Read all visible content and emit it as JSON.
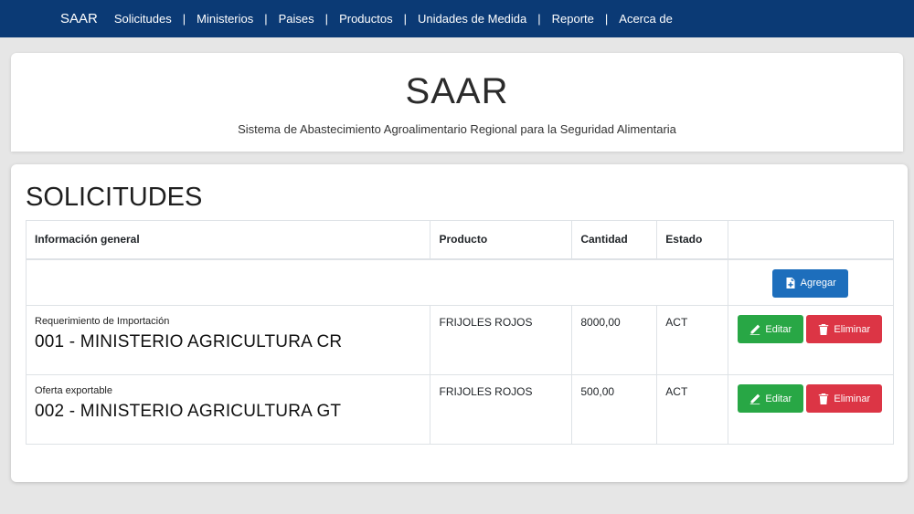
{
  "nav": {
    "brand": "SAAR",
    "items": [
      {
        "label": "Solicitudes"
      },
      {
        "label": "Ministerios"
      },
      {
        "label": "Paises"
      },
      {
        "label": "Productos"
      },
      {
        "label": "Unidades de Medida"
      },
      {
        "label": "Reporte"
      },
      {
        "label": "Acerca de"
      }
    ],
    "separator": "|"
  },
  "header": {
    "title": "SAAR",
    "subtitle": "Sistema de Abastecimiento Agroalimentario Regional para la Seguridad Alimentaria"
  },
  "main": {
    "title": "SOLICITUDES",
    "columns": {
      "info": "Información general",
      "product": "Producto",
      "quantity": "Cantidad",
      "status": "Estado"
    },
    "add_label": "Agregar",
    "edit_label": "Editar",
    "delete_label": "Eliminar",
    "rows": [
      {
        "type": "Requerimiento de Importación",
        "entity": "001 - MINISTERIO AGRICULTURA CR",
        "product": "FRIJOLES ROJOS",
        "quantity": "8000,00",
        "status": "ACT"
      },
      {
        "type": "Oferta exportable",
        "entity": "002 - MINISTERIO AGRICULTURA GT",
        "product": "FRIJOLES ROJOS",
        "quantity": "500,00",
        "status": "ACT"
      }
    ]
  },
  "colors": {
    "navbar": "#0b3a75",
    "add_button": "#1d6ebc",
    "edit_button": "#28a745",
    "delete_button": "#dc3545"
  },
  "icons": {
    "add": "file-plus-icon",
    "edit": "pencil-icon",
    "delete": "trash-icon"
  }
}
